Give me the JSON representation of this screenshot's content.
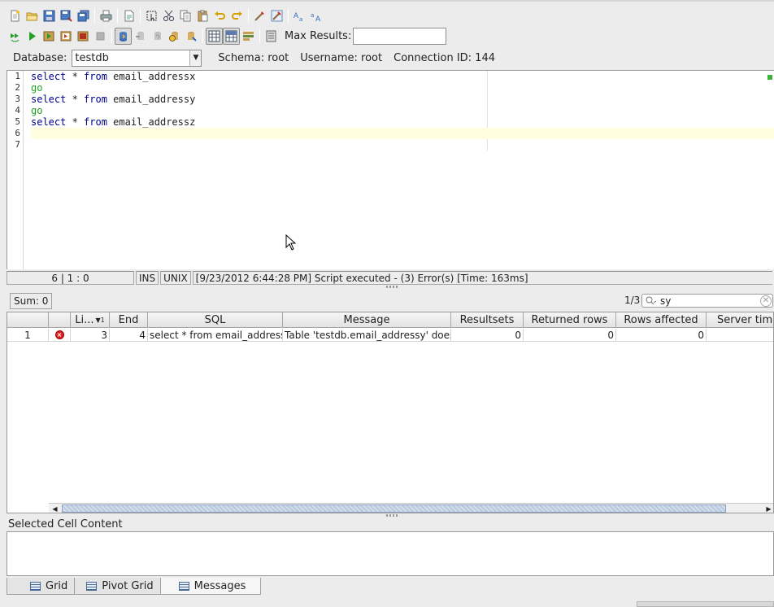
{
  "toolbar": {
    "max_results_label": "Max Results:",
    "max_results_value": "",
    "row1_icons": [
      "new-file-icon",
      "open-folder-icon",
      "save-icon",
      "save-as-icon",
      "save-all-icon",
      "print-icon",
      "export-icon",
      "select-all-icon",
      "cut-icon",
      "copy-icon",
      "paste-icon",
      "undo-icon",
      "redo-icon",
      "format-sql-icon",
      "format-options-icon",
      "uppercase-icon",
      "lowercase-icon"
    ],
    "row2_icons": [
      "execute-all-icon",
      "execute-icon",
      "execute-current-icon",
      "execute-explain-icon",
      "execute-to-file-icon",
      "stop-icon",
      "commit-mode-icon",
      "commit-icon",
      "rollback-icon",
      "history-icon",
      "transactions-icon",
      "grid-view-icon",
      "split-view-icon",
      "layout-icon",
      "settings-icon"
    ]
  },
  "connection": {
    "database_label": "Database:",
    "database_value": "testdb",
    "schema": "Schema:  root",
    "username": "Username:  root",
    "connection_id": "Connection ID:  144"
  },
  "editor": {
    "line_numbers": [
      "1",
      "2",
      "3",
      "4",
      "5",
      "6",
      "7"
    ],
    "lines": [
      {
        "kw1": "select",
        "mid": " * ",
        "kw2": "from",
        "rest": " email_addressx"
      },
      {
        "go": "go"
      },
      {
        "kw1": "select",
        "mid": " * ",
        "kw2": "from",
        "rest": " email_addressy"
      },
      {
        "go": "go"
      },
      {
        "kw1": "select",
        "mid": " * ",
        "kw2": "from",
        "rest": " email_addressz"
      }
    ]
  },
  "status": {
    "position": "6 | 1 : 0",
    "mode": "INS",
    "line_endings": "UNIX",
    "message": "[9/23/2012 6:44:28 PM] Script executed - (3) Error(s) [Time: 163ms]"
  },
  "results": {
    "sum": "Sum: 0",
    "pager": "1/3",
    "search_value": "sy",
    "columns": [
      "",
      "",
      "Li...",
      "End",
      "SQL",
      "Message",
      "Resultsets",
      "Returned rows",
      "Rows affected",
      "Server time"
    ],
    "sort_marker": "1",
    "rows": [
      {
        "row": "1",
        "line": "3",
        "end": "4",
        "sql": "select * from email_addressy",
        "message": "Table 'testdb.email_addressy' doesn't exist",
        "resultsets": "0",
        "returned_rows": "0",
        "rows_affected": "0",
        "server_time": ""
      }
    ]
  },
  "selected_cell": {
    "label": "Selected Cell Content",
    "value": ""
  },
  "tabs": [
    {
      "label": "Grid",
      "active": false
    },
    {
      "label": "Pivot Grid",
      "active": false
    },
    {
      "label": "Messages",
      "active": true
    }
  ]
}
